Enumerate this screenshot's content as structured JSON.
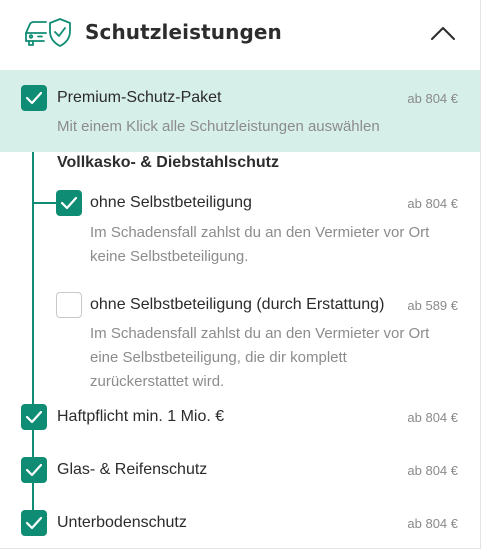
{
  "header": {
    "title": "Schutzleistungen",
    "icon": "car-shield-icon",
    "toggle_icon": "chevron-up-icon"
  },
  "colors": {
    "accent": "#0f8c74",
    "highlight_bg": "#d6efe9",
    "muted_text": "#8c8c8c"
  },
  "premium": {
    "label": "Premium-Schutz-Paket",
    "price": "ab 804 €",
    "description": "Mit einem Klick alle Schutzleistungen auswählen",
    "checked": true
  },
  "section": {
    "heading": "Vollkasko- & Diebstahlschutz",
    "options": [
      {
        "label": "ohne Selbstbeteiligung",
        "price": "ab 804 €",
        "description_lines": [
          "Im Schadensfall zahlst du an den Vermieter vor Ort",
          "keine Selbstbeteiligung."
        ],
        "checked": true
      },
      {
        "label": "ohne Selbstbeteiligung (durch Erstattung)",
        "price": "ab 589 €",
        "description_lines": [
          "Im Schadensfall zahlst du an den Vermieter vor Ort",
          "eine Selbstbeteiligung, die dir komplett",
          "zurückerstattet wird."
        ],
        "checked": false
      }
    ]
  },
  "items": [
    {
      "label": "Haftpflicht min. 1 Mio. €",
      "price": "ab 804 €",
      "checked": true
    },
    {
      "label": "Glas- & Reifenschutz",
      "price": "ab 804 €",
      "checked": true
    },
    {
      "label": "Unterbodenschutz",
      "price": "ab 804 €",
      "checked": true
    }
  ]
}
